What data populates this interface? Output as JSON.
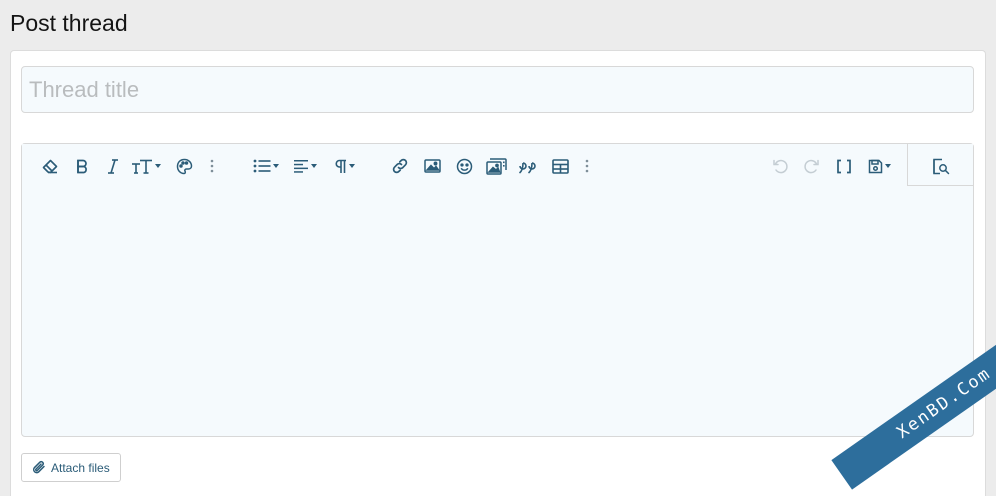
{
  "header": {
    "title": "Post thread"
  },
  "form": {
    "title_placeholder": "Thread title",
    "title_value": ""
  },
  "toolbar": {
    "buttons": [
      {
        "name": "clear-formatting",
        "icon": "eraser-icon"
      },
      {
        "name": "bold",
        "icon": "bold-icon"
      },
      {
        "name": "italic",
        "icon": "italic-icon"
      },
      {
        "name": "font-size",
        "icon": "text-size-icon"
      },
      {
        "name": "text-color",
        "icon": "palette-icon"
      },
      {
        "name": "more-text",
        "icon": "more-vertical-icon"
      },
      {
        "name": "list",
        "icon": "list-icon"
      },
      {
        "name": "align",
        "icon": "align-left-icon"
      },
      {
        "name": "paragraph",
        "icon": "paragraph-icon"
      },
      {
        "name": "insert-link",
        "icon": "link-icon"
      },
      {
        "name": "insert-image",
        "icon": "image-icon"
      },
      {
        "name": "smilies",
        "icon": "smiley-icon"
      },
      {
        "name": "media",
        "icon": "media-icon"
      },
      {
        "name": "quote",
        "icon": "quote-icon"
      },
      {
        "name": "insert-table",
        "icon": "table-icon"
      },
      {
        "name": "more-insert",
        "icon": "more-vertical-icon"
      },
      {
        "name": "undo",
        "icon": "undo-icon"
      },
      {
        "name": "redo",
        "icon": "redo-icon"
      },
      {
        "name": "toggle-bbcode",
        "icon": "brackets-icon"
      },
      {
        "name": "drafts",
        "icon": "save-icon"
      },
      {
        "name": "preview",
        "icon": "preview-icon"
      }
    ]
  },
  "attach": {
    "label": "Attach files",
    "icon": "paperclip-icon"
  },
  "watermark": {
    "text": "XenBD.Com"
  },
  "colors": {
    "accent": "#2b5c78",
    "field_bg": "#f5fafd",
    "page_bg": "#ececec",
    "watermark_bg": "#2d6e9c"
  }
}
